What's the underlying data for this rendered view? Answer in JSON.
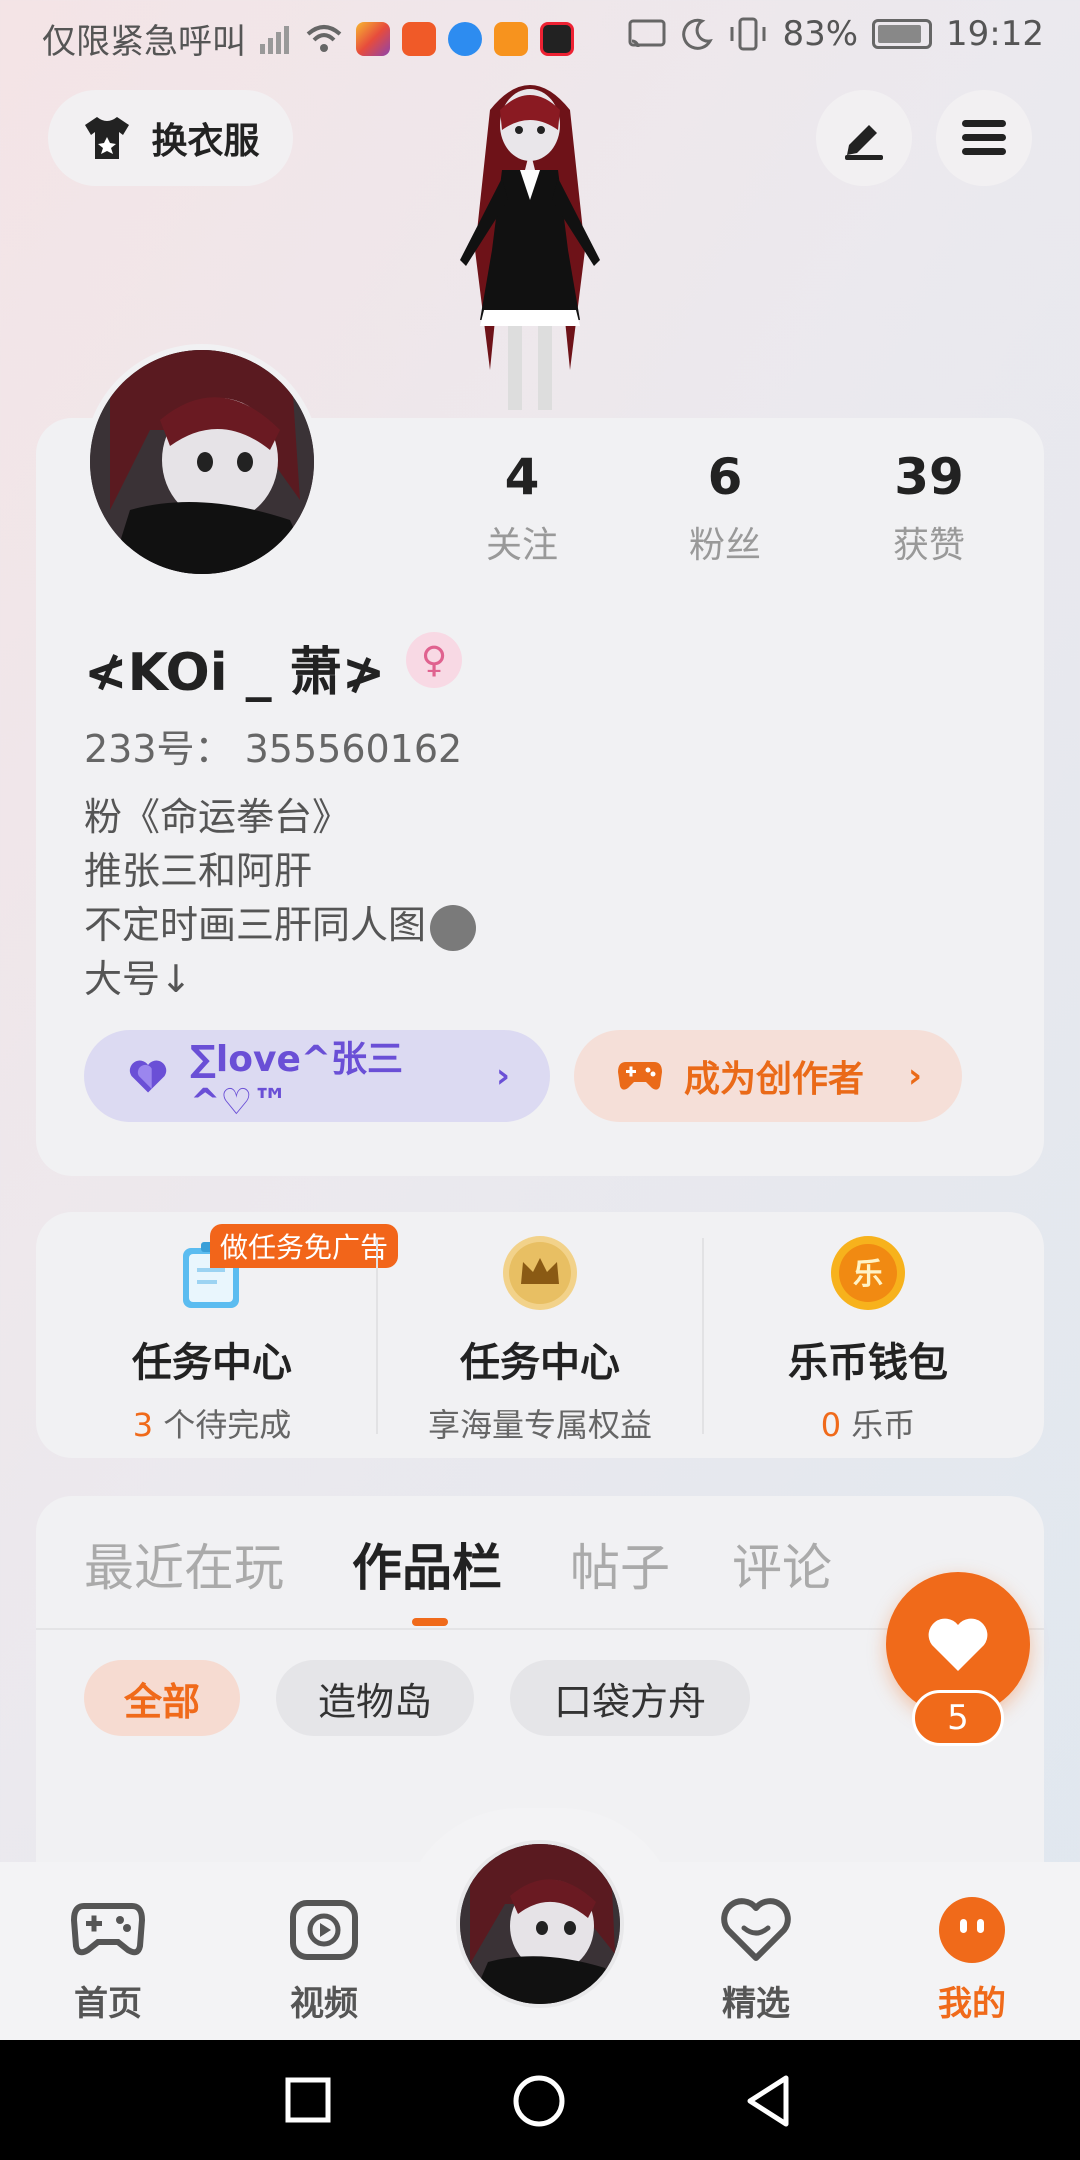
{
  "status_bar": {
    "carrier": "仅限紧急呼叫",
    "battery": "83%",
    "time": "19:12"
  },
  "top_bar": {
    "outfit_label": "换衣服"
  },
  "profile": {
    "stats": [
      {
        "value": "4",
        "label": "关注"
      },
      {
        "value": "6",
        "label": "粉丝"
      },
      {
        "value": "39",
        "label": "获赞"
      }
    ],
    "nickname": "≮KOi _ 萧≯",
    "gender_symbol": "♀",
    "uid": "233号： 355560162",
    "bio": [
      "粉《命运拳台》",
      "推张三和阿肝",
      "不定时画三肝同人图",
      "大号↓"
    ],
    "fan_badge": "∑love^张三^♡™",
    "creator_button": "成为创作者",
    "chevron": "›"
  },
  "tasks": {
    "badge": "做任务免广告",
    "items": [
      {
        "title": "任务中心",
        "count": "3",
        "sub": " 个待完成"
      },
      {
        "title": "任务中心",
        "count": "",
        "sub": "享海量专属权益"
      },
      {
        "title": "乐币钱包",
        "count": "0",
        "sub": " 乐币",
        "icon_text": "乐"
      }
    ]
  },
  "tabs": [
    "最近在玩",
    "作品栏",
    "帖子",
    "评论"
  ],
  "chips": [
    "全部",
    "造物岛",
    "口袋方舟"
  ],
  "like_count": "5",
  "bottom_nav": [
    "首页",
    "视频",
    "精选",
    "我的"
  ],
  "colors": {
    "accent": "#f06a1a",
    "fan_purple": "#6a4fd6",
    "card_bg": "#f1f1f3"
  }
}
